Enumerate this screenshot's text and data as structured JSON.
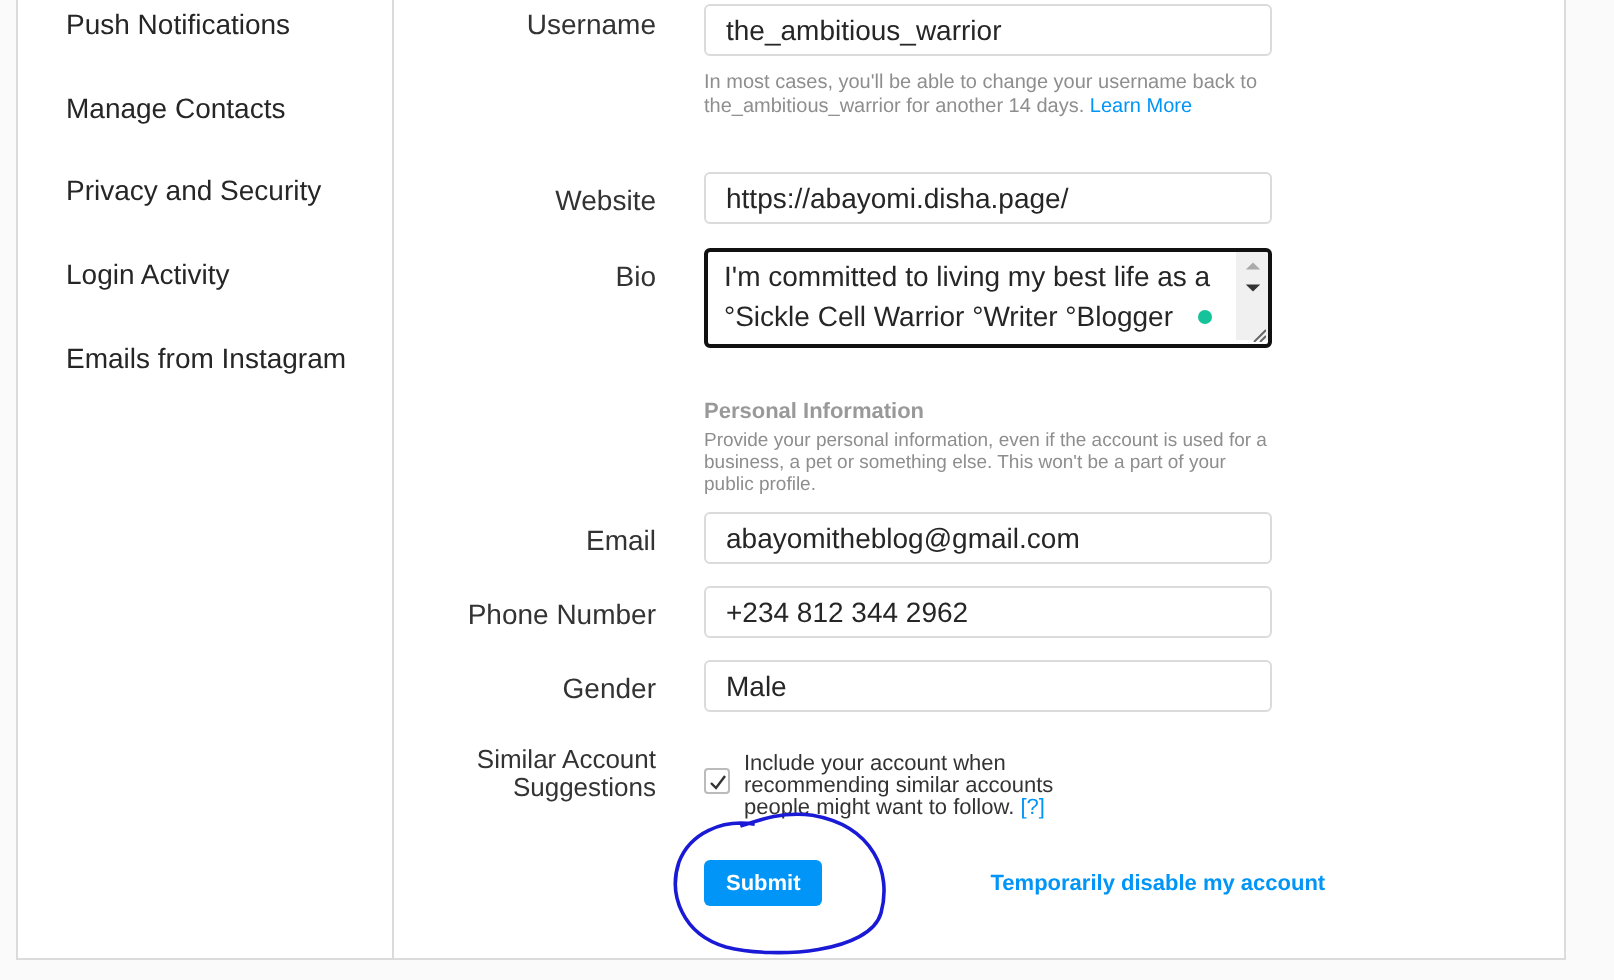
{
  "sidebar": {
    "items": [
      {
        "label": "Push Notifications",
        "selected": false
      },
      {
        "label": "Manage Contacts",
        "selected": false
      },
      {
        "label": "Privacy and Security",
        "selected": false
      },
      {
        "label": "Login Activity",
        "selected": false
      },
      {
        "label": "Emails from Instagram",
        "selected": false
      }
    ]
  },
  "form": {
    "username": {
      "label": "Username",
      "value": "the_ambitious_warrior",
      "hint": "In most cases, you'll be able to change your username back to the_ambitious_warrior for another 14 days.",
      "hint_link": "Learn More"
    },
    "website": {
      "label": "Website",
      "value": "https://abayomi.disha.page/"
    },
    "bio": {
      "label": "Bio",
      "value": "I'm committed to living my best life as a °Sickle Cell Warrior °Writer °Blogger"
    },
    "personal": {
      "heading": "Personal Information",
      "text": "Provide your personal information, even if the account is used for a business, a pet or something else. This won't be a part of your public profile."
    },
    "fields": [
      {
        "label": "Email",
        "value": "abayomitheblog@gmail.com"
      },
      {
        "label": "Phone Number",
        "value": "+234 812 344 2962"
      },
      {
        "label": "Gender",
        "value": "Male"
      }
    ],
    "suggestions": {
      "label": "Similar Account Suggestions",
      "checked": true,
      "text": "Include your account when recommending similar accounts people might want to follow.",
      "help_link": "[?]"
    },
    "submit": "Submit",
    "disable_link": "Temporarily disable my account"
  }
}
